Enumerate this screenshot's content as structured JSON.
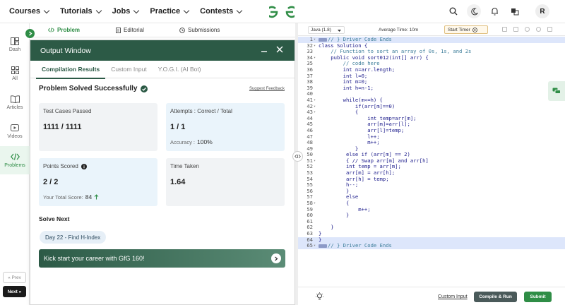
{
  "nav": {
    "menu": [
      "Courses",
      "Tutorials",
      "Jobs",
      "Practice",
      "Contests"
    ],
    "avatar_initial": "R",
    "brand_color": "#2f8d46"
  },
  "rail": {
    "items": [
      {
        "label": "Dash",
        "icon": "dashboard-icon"
      },
      {
        "label": "All",
        "icon": "grid-icon"
      },
      {
        "label": "Articles",
        "icon": "book-icon"
      },
      {
        "label": "Videos",
        "icon": "play-icon"
      },
      {
        "label": "Problems",
        "icon": "code-icon",
        "active": true
      }
    ],
    "prev": "« Prev",
    "next": "Next »"
  },
  "problem_tabs": [
    "Problem",
    "Editorial",
    "Submissions"
  ],
  "output": {
    "title": "Output Window",
    "tabs": [
      "Compilation Results",
      "Custom Input",
      "Y.O.G.I. (AI Bot)"
    ],
    "status": "Problem Solved Successfully",
    "suggest": "Suggest Feedback",
    "cards": {
      "tests_label": "Test Cases Passed",
      "tests_value": "1111 / 1111",
      "attempts_label": "Attempts : Correct / Total",
      "attempts_value": "1 / 1",
      "accuracy_label": "Accuracy :",
      "accuracy_value": "100%",
      "points_label": "Points Scored",
      "points_value": "2 / 2",
      "score_label": "Your Total Score:",
      "score_value": "84",
      "time_label": "Time Taken",
      "time_value": "1.64"
    },
    "solve_next": "Solve Next",
    "next_chip": "Day 22 - Find H-Index",
    "banner": "Kick start your career with GfG 160!"
  },
  "editor": {
    "language": "Java (1.8)",
    "avg_time": "Average Time: 10m",
    "start_timer": "Start Timer",
    "custom_input": "Custom Input",
    "compile_run": "Compile & Run",
    "submit": "Submit",
    "lines": [
      {
        "n": "1",
        "fold": true,
        "t": "// } Driver Code Ends",
        "hl": true,
        "cm": true,
        "box": true
      },
      {
        "n": "32",
        "fold": true,
        "t": "class Solution {"
      },
      {
        "n": "33",
        "t": "    // Function to sort an array of 0s, 1s, and 2s",
        "cm": true
      },
      {
        "n": "34",
        "fold": true,
        "t": "    public void sort012(int[] arr) {"
      },
      {
        "n": "35",
        "t": "        // code here",
        "cm": true
      },
      {
        "n": "36",
        "t": "        int n=arr.length;"
      },
      {
        "n": "37",
        "t": "        int l=0;"
      },
      {
        "n": "38",
        "t": "        int m=0;"
      },
      {
        "n": "39",
        "t": "        int h=n-1;"
      },
      {
        "n": "40",
        "t": ""
      },
      {
        "n": "41",
        "fold": true,
        "t": "        while(m<=h) {"
      },
      {
        "n": "42",
        "fold": true,
        "t": "            if(arr[m]==0)"
      },
      {
        "n": "43",
        "fold": true,
        "t": "            {"
      },
      {
        "n": "44",
        "t": "                int temp=arr[m];"
      },
      {
        "n": "45",
        "t": "                arr[m]=arr[l];"
      },
      {
        "n": "46",
        "t": "                arr[l]=temp;"
      },
      {
        "n": "47",
        "t": "                l++;"
      },
      {
        "n": "48",
        "t": "                m++;"
      },
      {
        "n": "49",
        "t": "            }"
      },
      {
        "n": "50",
        "t": "         else if (arr[m] == 2)"
      },
      {
        "n": "51",
        "fold": true,
        "t": "         { // Swap arr[m] and arr[h]"
      },
      {
        "n": "52",
        "t": "         int temp = arr[m];"
      },
      {
        "n": "53",
        "t": "         arr[m] = arr[h];"
      },
      {
        "n": "54",
        "t": "         arr[h] = temp;"
      },
      {
        "n": "55",
        "t": "         h--;"
      },
      {
        "n": "56",
        "t": "         }"
      },
      {
        "n": "57",
        "t": "         else"
      },
      {
        "n": "58",
        "fold": true,
        "t": "         {"
      },
      {
        "n": "59",
        "t": "             m++;"
      },
      {
        "n": "60",
        "t": "         }"
      },
      {
        "n": "61",
        "t": ""
      },
      {
        "n": "62",
        "t": "    }"
      },
      {
        "n": "63",
        "t": "}"
      },
      {
        "n": "64",
        "t": "}",
        "hl": true
      },
      {
        "n": "65",
        "fold": true,
        "t": "// } Driver Code Ends",
        "hl": true,
        "cm": true,
        "box": true
      }
    ]
  }
}
